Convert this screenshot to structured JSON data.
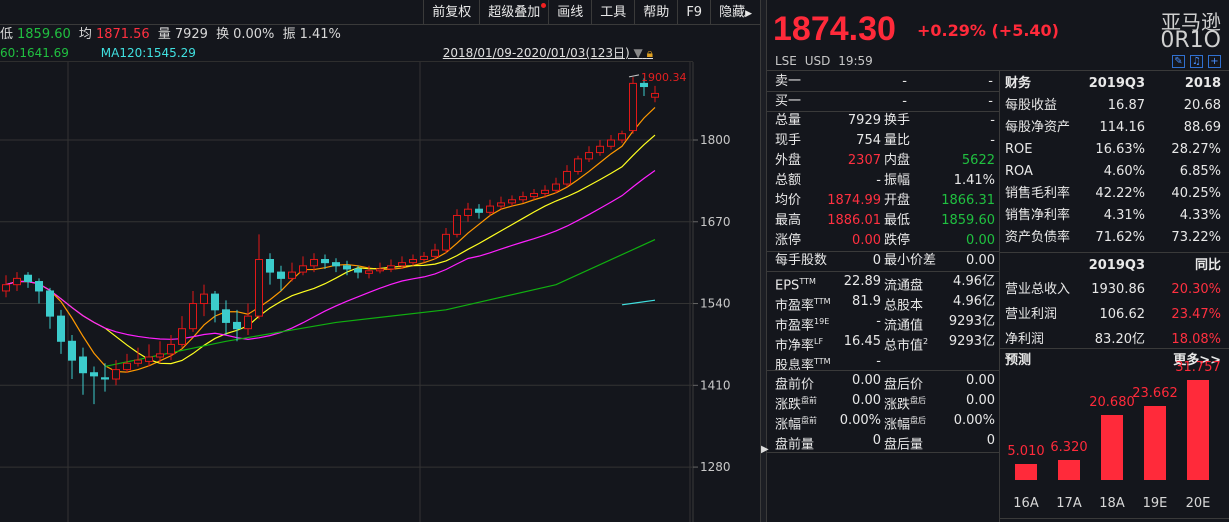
{
  "toolbar": {
    "buttons": [
      "前复权",
      "超级叠加",
      "画线",
      "工具",
      "帮助",
      "F9",
      "隐藏"
    ]
  },
  "info": {
    "low_label": "低",
    "low": "1859.60",
    "avg_label": "均",
    "avg": "1871.56",
    "vol_label": "量",
    "vol": "7929",
    "turn_label": "换",
    "turn": "0.00%",
    "amp_label": "振",
    "amp": "1.41%"
  },
  "ma": {
    "ma60": "60:1641.69",
    "ma120": "MA120:1545.29",
    "range": "2018/01/09-2020/01/03(123日)"
  },
  "chart_data": {
    "type": "candlestick",
    "yticks": [
      1800,
      1670,
      1540,
      1410,
      1280
    ],
    "ylim": [
      1240,
      1900
    ],
    "max_label": "1900.34",
    "candles": [
      [
        1560,
        1585,
        1550,
        1570
      ],
      [
        1570,
        1590,
        1560,
        1580
      ],
      [
        1585,
        1590,
        1565,
        1575
      ],
      [
        1575,
        1580,
        1540,
        1560
      ],
      [
        1560,
        1565,
        1500,
        1520
      ],
      [
        1520,
        1530,
        1460,
        1480
      ],
      [
        1480,
        1490,
        1420,
        1450
      ],
      [
        1455,
        1470,
        1395,
        1430
      ],
      [
        1430,
        1440,
        1380,
        1425
      ],
      [
        1422,
        1445,
        1400,
        1420
      ],
      [
        1420,
        1450,
        1410,
        1435
      ],
      [
        1435,
        1460,
        1430,
        1445
      ],
      [
        1445,
        1470,
        1440,
        1450
      ],
      [
        1448,
        1475,
        1440,
        1455
      ],
      [
        1455,
        1480,
        1445,
        1460
      ],
      [
        1460,
        1490,
        1450,
        1475
      ],
      [
        1475,
        1520,
        1470,
        1500
      ],
      [
        1500,
        1560,
        1495,
        1540
      ],
      [
        1540,
        1570,
        1520,
        1555
      ],
      [
        1555,
        1560,
        1510,
        1530
      ],
      [
        1530,
        1545,
        1490,
        1510
      ],
      [
        1510,
        1530,
        1480,
        1500
      ],
      [
        1500,
        1540,
        1490,
        1520
      ],
      [
        1520,
        1650,
        1515,
        1610
      ],
      [
        1610,
        1620,
        1570,
        1590
      ],
      [
        1590,
        1600,
        1560,
        1580
      ],
      [
        1580,
        1605,
        1575,
        1590
      ],
      [
        1590,
        1615,
        1585,
        1600
      ],
      [
        1600,
        1620,
        1590,
        1610
      ],
      [
        1610,
        1618,
        1595,
        1605
      ],
      [
        1605,
        1612,
        1590,
        1600
      ],
      [
        1600,
        1608,
        1585,
        1595
      ],
      [
        1595,
        1600,
        1580,
        1590
      ],
      [
        1588,
        1600,
        1580,
        1592
      ],
      [
        1592,
        1605,
        1588,
        1595
      ],
      [
        1595,
        1610,
        1590,
        1600
      ],
      [
        1600,
        1615,
        1595,
        1605
      ],
      [
        1605,
        1618,
        1600,
        1610
      ],
      [
        1610,
        1622,
        1605,
        1615
      ],
      [
        1615,
        1635,
        1610,
        1625
      ],
      [
        1625,
        1660,
        1620,
        1650
      ],
      [
        1650,
        1690,
        1645,
        1680
      ],
      [
        1680,
        1700,
        1670,
        1690
      ],
      [
        1690,
        1698,
        1675,
        1685
      ],
      [
        1685,
        1705,
        1680,
        1695
      ],
      [
        1695,
        1710,
        1690,
        1700
      ],
      [
        1700,
        1712,
        1695,
        1705
      ],
      [
        1705,
        1718,
        1700,
        1710
      ],
      [
        1710,
        1722,
        1705,
        1715
      ],
      [
        1715,
        1728,
        1708,
        1720
      ],
      [
        1720,
        1740,
        1715,
        1730
      ],
      [
        1730,
        1760,
        1725,
        1750
      ],
      [
        1750,
        1775,
        1745,
        1770
      ],
      [
        1770,
        1790,
        1765,
        1780
      ],
      [
        1780,
        1800,
        1775,
        1790
      ],
      [
        1790,
        1808,
        1785,
        1800
      ],
      [
        1800,
        1815,
        1795,
        1810
      ],
      [
        1815,
        1900,
        1810,
        1890
      ],
      [
        1890,
        1898,
        1870,
        1885
      ],
      [
        1868,
        1886,
        1860,
        1874
      ]
    ],
    "ma_series": [
      {
        "name": "MA5",
        "color": "#ff9900",
        "window": 5
      },
      {
        "name": "MA10",
        "color": "#ffff20",
        "window": 10
      },
      {
        "name": "MA20",
        "color": "#ff20ff",
        "window": 20
      }
    ],
    "ma60": {
      "color": "#10b010",
      "points": [
        [
          9,
          1440
        ],
        [
          20,
          1480
        ],
        [
          30,
          1510
        ],
        [
          40,
          1530
        ],
        [
          50,
          1570
        ],
        [
          59,
          1641.69
        ]
      ]
    },
    "ma120": {
      "color": "#40e0e0",
      "points": [
        [
          56,
          1538
        ],
        [
          59,
          1545.29
        ]
      ]
    }
  },
  "quote": {
    "price": "1874.30",
    "change": "+0.29% (+5.40)",
    "name": "亚马逊",
    "code": "0R1O",
    "exchange": "LSE",
    "currency": "USD",
    "time": "19:59"
  },
  "orderbook": [
    {
      "label": "卖一",
      "price": "-",
      "vol": "-"
    },
    {
      "label": "买一",
      "price": "-",
      "vol": "-"
    }
  ],
  "stats": [
    {
      "l1": "总量",
      "v1": "7929",
      "c1": "white",
      "l2": "换手",
      "v2": "-",
      "c2": "white"
    },
    {
      "l1": "现手",
      "v1": "754",
      "c1": "white",
      "l2": "量比",
      "v2": "-",
      "c2": "white"
    },
    {
      "l1": "外盘",
      "v1": "2307",
      "c1": "red",
      "l2": "内盘",
      "v2": "5622",
      "c2": "green"
    },
    {
      "l1": "总额",
      "v1": "-",
      "c1": "white",
      "l2": "振幅",
      "v2": "1.41%",
      "c2": "white"
    },
    {
      "l1": "均价",
      "v1": "1874.99",
      "c1": "red",
      "l2": "开盘",
      "v2": "1866.31",
      "c2": "green"
    },
    {
      "l1": "最高",
      "v1": "1886.01",
      "c1": "red",
      "l2": "最低",
      "v2": "1859.60",
      "c2": "green"
    },
    {
      "l1": "涨停",
      "v1": "0.00",
      "c1": "red",
      "l2": "跌停",
      "v2": "0.00",
      "c2": "green"
    }
  ],
  "lot": {
    "l1": "每手股数",
    "v1": "0",
    "l2": "最小价差",
    "v2": "0.00"
  },
  "valuation": [
    {
      "l1": "EPS",
      "s1": "TTM",
      "v1": "22.89",
      "l2": "流通盘",
      "s2": "",
      "v2": "4.96亿"
    },
    {
      "l1": "市盈率",
      "s1": "TTM",
      "v1": "81.9",
      "l2": "总股本",
      "s2": "",
      "v2": "4.96亿"
    },
    {
      "l1": "市盈率",
      "s1": "19E",
      "v1": "-",
      "l2": "流通值",
      "s2": "",
      "v2": "9293亿"
    },
    {
      "l1": "市净率",
      "s1": "LF",
      "v1": "16.45",
      "l2": "总市值",
      "s2": "2",
      "v2": "9293亿"
    },
    {
      "l1": "股息率",
      "s1": "TTM",
      "v1": "-",
      "l2": "",
      "s2": "",
      "v2": ""
    }
  ],
  "extended": [
    {
      "l1": "盘前价",
      "s1": "",
      "v1": "0.00",
      "l2": "盘后价",
      "s2": "",
      "v2": "0.00"
    },
    {
      "l1": "涨跌",
      "s1": "盘前",
      "v1": "0.00",
      "l2": "涨跌",
      "s2": "盘后",
      "v2": "0.00"
    },
    {
      "l1": "涨幅",
      "s1": "盘前",
      "v1": "0.00%",
      "l2": "涨幅",
      "s2": "盘后",
      "v2": "0.00%"
    },
    {
      "l1": "盘前量",
      "s1": "",
      "v1": "0",
      "l2": "盘后量",
      "s2": "",
      "v2": "0"
    }
  ],
  "finance": {
    "header": [
      "财务",
      "2019Q3",
      "2018"
    ],
    "rows": [
      [
        "每股收益",
        "16.87",
        "20.68"
      ],
      [
        "每股净资产",
        "114.16",
        "88.69"
      ],
      [
        "ROE",
        "16.63%",
        "28.27%"
      ],
      [
        "ROA",
        "4.60%",
        "6.85%"
      ],
      [
        "销售毛利率",
        "42.22%",
        "40.25%"
      ],
      [
        "销售净利率",
        "4.31%",
        "4.33%"
      ],
      [
        "资产负债率",
        "71.62%",
        "73.22%"
      ]
    ]
  },
  "growth": {
    "header": [
      "",
      "2019Q3",
      "同比"
    ],
    "rows": [
      [
        "营业总收入",
        "1930.86",
        "20.30%"
      ],
      [
        "营业利润",
        "106.62",
        "23.47%"
      ],
      [
        "净利润",
        "83.20亿",
        "18.08%"
      ]
    ]
  },
  "forecast": {
    "title": "预测",
    "more": "更多>>",
    "bars": [
      {
        "label": "16A",
        "value": 5.01,
        "text": "5.010"
      },
      {
        "label": "17A",
        "value": 6.32,
        "text": "6.320"
      },
      {
        "label": "18A",
        "value": 20.68,
        "text": "20.680"
      },
      {
        "label": "19E",
        "value": 23.662,
        "text": "23.662"
      },
      {
        "label": "20E",
        "value": 31.757,
        "text": "31.757"
      }
    ]
  }
}
